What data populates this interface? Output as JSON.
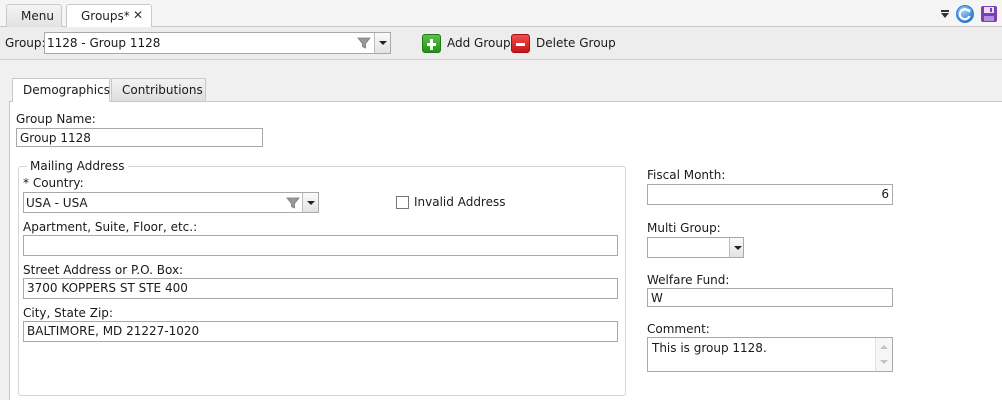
{
  "tabs": {
    "menu_label": "Menu",
    "active_label": "Groups*",
    "close_glyph": "✕"
  },
  "toolbar": {
    "group_label": "Group:",
    "group_value": "1128 - Group 1128",
    "add_group_label": "Add Group",
    "delete_group_label": "Delete Group"
  },
  "inner_tabs": [
    "Demographics",
    "Contributions"
  ],
  "form": {
    "group_name_label": "Group Name:",
    "group_name_value": "Group 1128",
    "mailing_address_title": "Mailing Address",
    "country_label": "* Country:",
    "country_value": "USA - USA",
    "invalid_address_label": "Invalid Address",
    "invalid_address_checked": false,
    "apartment_label": "Apartment, Suite, Floor, etc.:",
    "apartment_value": "",
    "street_label": "Street Address or P.O. Box:",
    "street_value": "3700 KOPPERS ST STE 400",
    "city_label": "City, State Zip:",
    "city_value": "BALTIMORE, MD 21227-1020",
    "fiscal_month_label": "Fiscal Month:",
    "fiscal_month_value": "6",
    "multi_group_label": "Multi Group:",
    "multi_group_value": "",
    "welfare_fund_label": "Welfare Fund:",
    "welfare_fund_value": "W",
    "comment_label": "Comment:",
    "comment_value": "This is group 1128."
  },
  "colors": {
    "add_icon": "#2f9e23",
    "delete_icon": "#d61f1f",
    "refresh_icon": "#2b7fd8",
    "save_icon": "#7a3fb0"
  }
}
